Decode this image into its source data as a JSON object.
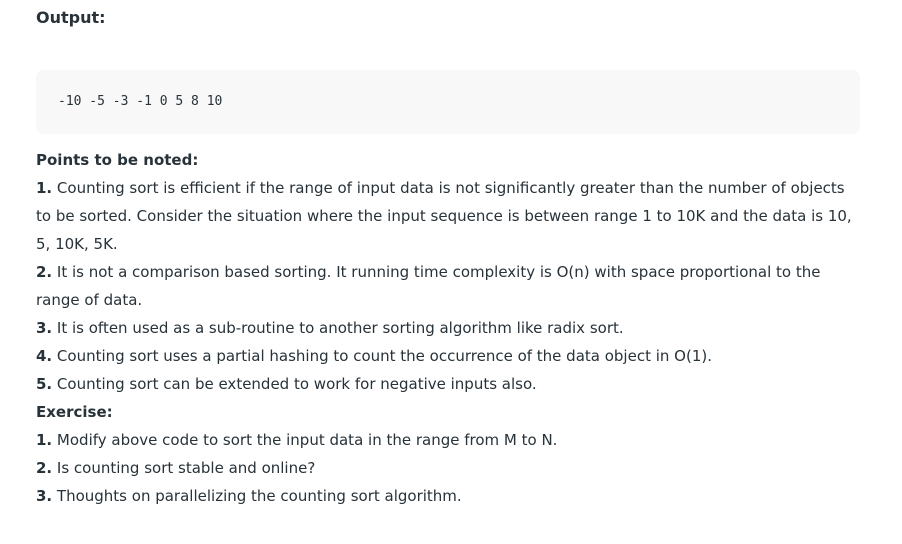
{
  "output": {
    "heading": "Output:",
    "code": "-10 -5 -3 -1 0 5 8 10"
  },
  "notes": {
    "heading": "Points to be noted:",
    "items": [
      {
        "num": "1.",
        "lines": [
          "Counting sort is efficient if the range of input data is not significantly greater than the number of objects",
          "to be sorted. Consider the situation where the input sequence is between range 1 to 10K and the data is 10,",
          "5, 10K, 5K."
        ]
      },
      {
        "num": "2.",
        "lines": [
          "It is not a comparison based sorting. It running time complexity is O(n) with space proportional to the",
          "range of data."
        ]
      },
      {
        "num": "3.",
        "lines": [
          "It is often used as a sub-routine to another sorting algorithm like radix sort."
        ]
      },
      {
        "num": "4.",
        "lines": [
          "Counting sort uses a partial hashing to count the occurrence of the data object in O(1)."
        ]
      },
      {
        "num": "5.",
        "lines": [
          "Counting sort can be extended to work for negative inputs also."
        ]
      }
    ]
  },
  "exercise": {
    "heading": "Exercise:",
    "items": [
      {
        "num": "1.",
        "lines": [
          "Modify above code to sort the input data in the range from M to N."
        ]
      },
      {
        "num": "2.",
        "lines": [
          "Is counting sort stable and online?"
        ]
      },
      {
        "num": "3.",
        "lines": [
          "Thoughts on parallelizing the counting sort algorithm."
        ]
      }
    ]
  }
}
